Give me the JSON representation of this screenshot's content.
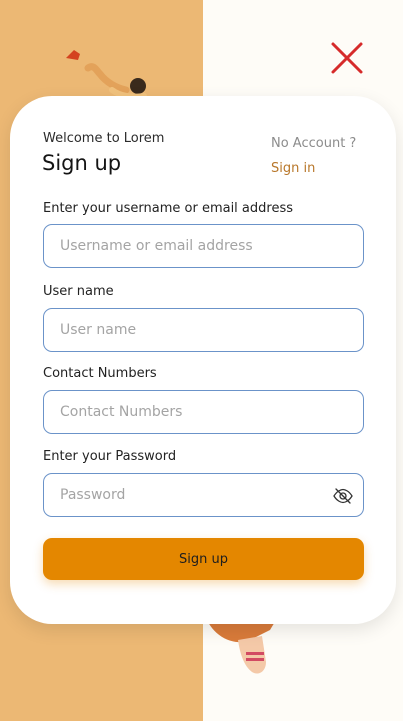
{
  "header": {
    "welcome": "Welcome to Lorem",
    "title": "Sign up",
    "no_account": "No Account ?",
    "sign_in": "Sign in"
  },
  "form": {
    "email": {
      "label": "Enter your username or email address",
      "placeholder": "Username or email address",
      "value": ""
    },
    "username": {
      "label": "User name",
      "placeholder": "User name",
      "value": ""
    },
    "contact": {
      "label": "Contact Numbers",
      "placeholder": "Contact Numbers",
      "value": ""
    },
    "password": {
      "label": "Enter your Password",
      "placeholder": "Password",
      "value": ""
    },
    "submit_label": "Sign up"
  },
  "icons": {
    "close": "close-icon",
    "password_toggle": "eye-icon"
  },
  "colors": {
    "left_panel": "#ecb874",
    "right_panel": "#fefcf7",
    "accent": "#e48700",
    "link": "#b8772a",
    "close": "#d62b2b",
    "input_border": "#6b93c9"
  }
}
